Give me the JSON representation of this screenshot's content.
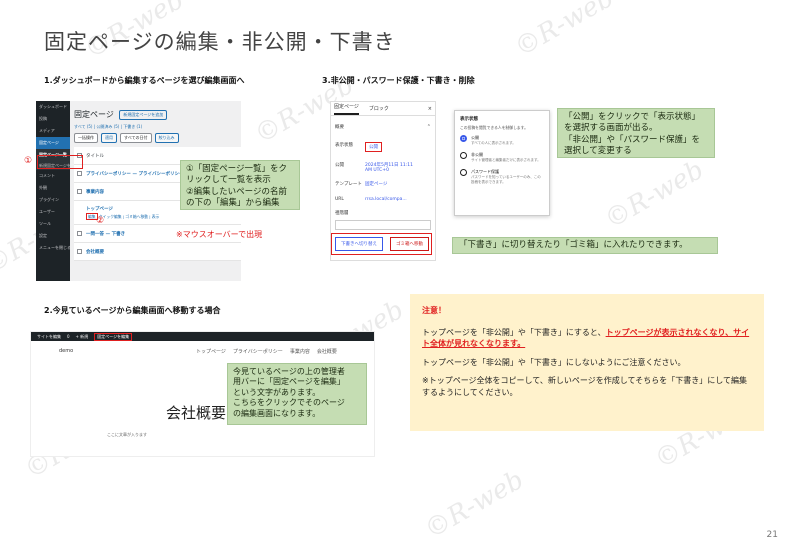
{
  "title": "固定ページの編集・非公開・下書き",
  "section1": {
    "heading": "1.ダッシュボードから編集するページを選び編集画面へ"
  },
  "section2": {
    "heading": "2.今見ているページから編集画面へ移動する場合"
  },
  "section3": {
    "heading": "3.非公開・パスワード保護・下書き・削除"
  },
  "wp_list": {
    "sidebar": [
      "ダッシュボード",
      "投稿",
      "メディア",
      "固定ページ",
      "固定ページ一覧",
      "新規固定ページを追加",
      "コメント",
      "外観",
      "プラグイン",
      "ユーザー",
      "ツール",
      "設定",
      "メニューを閉じる"
    ],
    "heading": "固定ページ",
    "add_button": "新規固定ページを追加",
    "filter": "すべて (5) | 公開済み (5) | 下書き (1)",
    "bulk_select": "一括操作",
    "apply_button": "適用",
    "date_select": "すべての日付",
    "filter_button": "絞り込み",
    "col_title": "タイトル",
    "rows": [
      "プライバシーポリシー — プライバシーポリシーページ",
      "事業内容",
      "トップページ",
      "一問一答 — 下書き",
      "会社概要"
    ],
    "row_actions": "クイック編集 | ゴミ箱へ移動 | 表示",
    "edit_link": "編集"
  },
  "callout1": {
    "line1": "①「固定ページ一覧」をク",
    "line2": "リックして一覧を表示",
    "line3": "②編集したいページの名前",
    "line4": "の下の「編集」から編集"
  },
  "marker1": "①",
  "marker2": "②",
  "hover_note": "※マウスオーバーで出現",
  "editor": {
    "tab_page": "固定ページ",
    "tab_block": "ブロック",
    "close": "×",
    "summary": "概要",
    "rows": [
      {
        "k": "表示状態",
        "v": "公開"
      },
      {
        "k": "公開",
        "v": "2024年5月11日 11:11 AM UTC+0"
      },
      {
        "k": "テンプレート",
        "v": "固定ページ"
      },
      {
        "k": "URL",
        "v": "rrsa.local/compa..."
      },
      {
        "k": "祖階層",
        "v": ""
      }
    ],
    "draft_button": "下書きへ切り替え",
    "trash_button": "ゴミ箱へ移動"
  },
  "visibility": {
    "title": "表示状態",
    "desc": "この投稿を閲覧できる人を制御します。",
    "options": [
      {
        "label": "公開",
        "sub": "すべての人に表示されます。"
      },
      {
        "label": "非公開",
        "sub": "サイト管理者と編集者だけに表示されます。"
      },
      {
        "label": "パスワード保護",
        "sub": "パスワードを知っているユーザーのみ、この投稿を表示できます。"
      }
    ]
  },
  "callout2": {
    "line1": "「公開」をクリックで「表示状態」",
    "line2": "を選択する画面が出る。",
    "line3": "「非公開」や「パスワード保護」を",
    "line4": "選択して変更する"
  },
  "callout3": "「下書き」に切り替えたり「ゴミ箱」に入れたりできます。",
  "front": {
    "admin_items": [
      "サイトを編集",
      "0",
      "+ 新規",
      "固定ページを編集"
    ],
    "site_name": "demo",
    "nav": [
      "トップページ",
      "プライバシーポリシー",
      "事業内容",
      "会社概要"
    ],
    "page_title": "会社概要",
    "body_text": "ここに文章が入ります"
  },
  "callout4": {
    "line1": "今見ているページの上の管理者",
    "line2": "用バーに「固定ページを編集」",
    "line3": "という文字があります。",
    "line4": "こちらをクリックでそのページ",
    "line5": "の編集画面になります。"
  },
  "note": {
    "heading": "注意！",
    "p1_before": "トップページを「非公開」や「下書き」にすると、",
    "p1_warn": "トップページが表示されなくなり、サイト全体が見れなくなります。",
    "p2": "トップページを「非公開」や「下書き」にしないようにご注意ください。",
    "p3": "※トップページ全体をコピーして、新しいページを作成してそちらを「下書き」にして編集するようにしてください。"
  },
  "page_number": "21",
  "watermark": "©R-web",
  "colors": {
    "accent_red": "#e02020",
    "callout_green": "#c5ddb3",
    "note_yellow": "#fff2cc",
    "wp_blue": "#2271b1"
  }
}
